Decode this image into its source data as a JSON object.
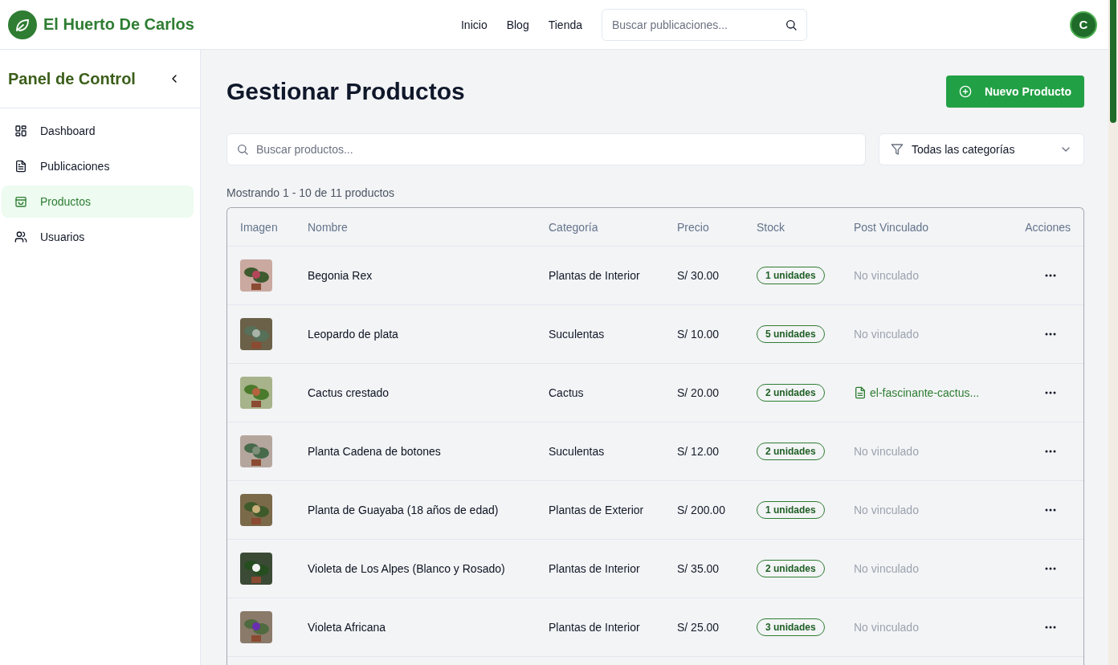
{
  "header": {
    "brand": "El Huerto De Carlos",
    "nav": [
      "Inicio",
      "Blog",
      "Tienda"
    ],
    "search": {
      "placeholder": "Buscar publicaciones..."
    },
    "avatar": "C"
  },
  "sidebar": {
    "title": "Panel de Control",
    "items": [
      {
        "label": "Dashboard",
        "selected": false
      },
      {
        "label": "Publicaciones",
        "selected": false
      },
      {
        "label": "Productos",
        "selected": true
      },
      {
        "label": "Usuarios",
        "selected": false
      }
    ]
  },
  "page": {
    "title": "Gestionar Productos",
    "new_button": "Nuevo Producto",
    "search": {
      "placeholder": "Buscar productos..."
    },
    "category_filter": "Todas las categorías",
    "summary": "Mostrando 1 - 10 de 11 productos"
  },
  "table": {
    "columns": [
      "Imagen",
      "Nombre",
      "Categoría",
      "Precio",
      "Stock",
      "Post Vinculado",
      "Acciones"
    ],
    "rows": [
      {
        "name": "Begonia Rex",
        "category": "Plantas de Interior",
        "price": "S/ 30.00",
        "stock": "1 unidades",
        "post": "No vinculado",
        "linked": false
      },
      {
        "name": "Leopardo de plata",
        "category": "Suculentas",
        "price": "S/ 10.00",
        "stock": "5 unidades",
        "post": "No vinculado",
        "linked": false
      },
      {
        "name": "Cactus crestado",
        "category": "Cactus",
        "price": "S/ 20.00",
        "stock": "2 unidades",
        "post": "el-fascinante-cactus...",
        "linked": true
      },
      {
        "name": "Planta Cadena de botones",
        "category": "Suculentas",
        "price": "S/ 12.00",
        "stock": "2 unidades",
        "post": "No vinculado",
        "linked": false
      },
      {
        "name": "Planta de Guayaba (18 años de edad)",
        "category": "Plantas de Exterior",
        "price": "S/ 200.00",
        "stock": "1 unidades",
        "post": "No vinculado",
        "linked": false
      },
      {
        "name": "Violeta de Los Alpes (Blanco y Rosado)",
        "category": "Plantas de Interior",
        "price": "S/ 35.00",
        "stock": "2 unidades",
        "post": "No vinculado",
        "linked": false
      },
      {
        "name": "Violeta Africana",
        "category": "Plantas de Interior",
        "price": "S/ 25.00",
        "stock": "3 unidades",
        "post": "No vinculado",
        "linked": false
      }
    ]
  }
}
